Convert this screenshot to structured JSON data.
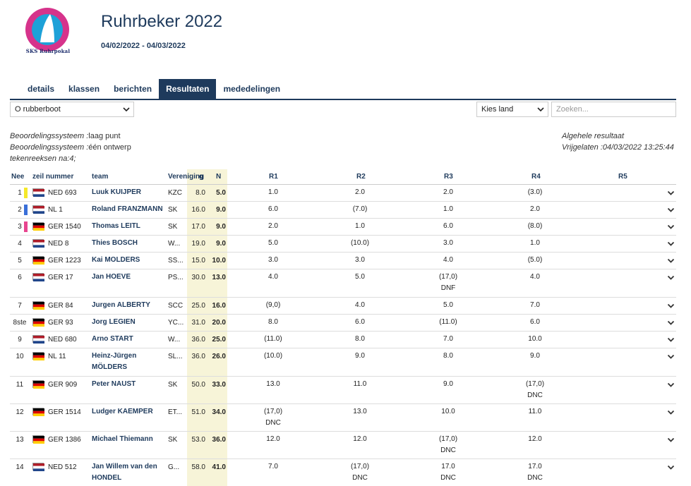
{
  "logo": {
    "text": "SKS Ruhrpokal",
    "colors": {
      "ring": "#d6338b",
      "inner": "#1da1d8",
      "sail": "#ffffff"
    }
  },
  "event": {
    "title": "Ruhrbeker 2022",
    "dates": "04/02/2022 - 04/03/2022"
  },
  "tabs": [
    {
      "label": "details",
      "active": false
    },
    {
      "label": "klassen",
      "active": false
    },
    {
      "label": "berichten",
      "active": false
    },
    {
      "label": "Resultaten",
      "active": true
    },
    {
      "label": "mededelingen",
      "active": false
    }
  ],
  "filters": {
    "class_select": "O rubberboot",
    "country_select": "Kies land",
    "search_placeholder": "Zoeken..."
  },
  "info": {
    "scoring_label_1": "Beoordelingssysteem :",
    "scoring_value_1": "laag punt",
    "scoring_label_2": "Beoordelingssysteem :",
    "scoring_value_2": "één ontwerp",
    "discards_label": "tekenreeksen na:",
    "discards_value": "4;",
    "overall": "Algehele resultaat",
    "released_label": "Vrijgelaten :",
    "released_value": "04/03/2022 13:25:44"
  },
  "table": {
    "headers": {
      "rank": "Nee",
      "sail": "zeil nummer",
      "team": "team",
      "club": "Vereniging",
      "g": "g",
      "n": "N",
      "r1": "R1",
      "r2": "R2",
      "r3": "R3",
      "r4": "R4",
      "r5": "R5"
    },
    "rows": [
      {
        "rank": "1",
        "color": "#f5e829",
        "flag": "NED",
        "sail": "NED 693",
        "name1": "Luuk KUIJPER",
        "name2": "",
        "club": "KZC",
        "g": "8.0",
        "n": "5.0",
        "r1": [
          "1.0",
          ""
        ],
        "r2": [
          "2.0",
          ""
        ],
        "r3": [
          "2.0",
          ""
        ],
        "r4": [
          "(3.0)",
          ""
        ]
      },
      {
        "rank": "2",
        "color": "#3a6fd8",
        "flag": "NED",
        "sail": "NL 1",
        "name1": "Roland FRANZMANN",
        "name2": "",
        "club": "SK",
        "g": "16.0",
        "n": "9.0",
        "r1": [
          "6.0",
          ""
        ],
        "r2": [
          "(7.0)",
          ""
        ],
        "r3": [
          "1.0",
          ""
        ],
        "r4": [
          "2.0",
          ""
        ]
      },
      {
        "rank": "3",
        "color": "#e8458f",
        "flag": "GER",
        "sail": "GER 1540",
        "name1": "Thomas LEITL",
        "name2": "",
        "club": "SK",
        "g": "17.0",
        "n": "9.0",
        "r1": [
          "2.0",
          ""
        ],
        "r2": [
          "1.0",
          ""
        ],
        "r3": [
          "6.0",
          ""
        ],
        "r4": [
          "(8.0)",
          ""
        ]
      },
      {
        "rank": "4",
        "color": "",
        "flag": "NED",
        "sail": "NED 8",
        "name1": "Thies BOSCH",
        "name2": "",
        "club": "W...",
        "g": "19.0",
        "n": "9.0",
        "r1": [
          "5.0",
          ""
        ],
        "r2": [
          "(10.0)",
          ""
        ],
        "r3": [
          "3.0",
          ""
        ],
        "r4": [
          "1.0",
          ""
        ]
      },
      {
        "rank": "5",
        "color": "",
        "flag": "GER",
        "sail": "GER 1223",
        "name1": "Kai MOLDERS",
        "name2": "",
        "club": "SS...",
        "g": "15.0",
        "n": "10.0",
        "r1": [
          "3.0",
          ""
        ],
        "r2": [
          "3.0",
          ""
        ],
        "r3": [
          "4.0",
          ""
        ],
        "r4": [
          "(5.0)",
          ""
        ]
      },
      {
        "rank": "6",
        "color": "",
        "flag": "NED",
        "sail": "GER 17",
        "name1": "Jan HOEVE",
        "name2": "",
        "club": "PS...",
        "g": "30.0",
        "n": "13.0",
        "r1": [
          "4.0",
          ""
        ],
        "r2": [
          "5.0",
          ""
        ],
        "r3": [
          "(17,0)",
          "DNF"
        ],
        "r4": [
          "4.0",
          ""
        ]
      },
      {
        "rank": "7",
        "color": "",
        "flag": "GER",
        "sail": "GER 84",
        "name1": "Jurgen ALBERTY",
        "name2": "",
        "club": "SCC",
        "g": "25.0",
        "n": "16.0",
        "r1": [
          "(9,0)",
          ""
        ],
        "r2": [
          "4.0",
          ""
        ],
        "r3": [
          "5.0",
          ""
        ],
        "r4": [
          "7.0",
          ""
        ]
      },
      {
        "rank": "8ste",
        "color": "",
        "flag": "GER",
        "sail": "GER 93",
        "name1": "Jorg LEGIEN",
        "name2": "",
        "club": "YC...",
        "g": "31.0",
        "n": "20.0",
        "r1": [
          "8.0",
          ""
        ],
        "r2": [
          "6.0",
          ""
        ],
        "r3": [
          "(11.0)",
          ""
        ],
        "r4": [
          "6.0",
          ""
        ]
      },
      {
        "rank": "9",
        "color": "",
        "flag": "NED",
        "sail": "NED 680",
        "name1": "Arno START",
        "name2": "",
        "club": "W...",
        "g": "36.0",
        "n": "25.0",
        "r1": [
          "(11.0)",
          ""
        ],
        "r2": [
          "8.0",
          ""
        ],
        "r3": [
          "7.0",
          ""
        ],
        "r4": [
          "10.0",
          ""
        ]
      },
      {
        "rank": "10",
        "color": "",
        "flag": "GER",
        "sail": "NL 11",
        "name1": "Heinz-Jürgen",
        "name2": "MÖLDERS",
        "club": "SL...",
        "g": "36.0",
        "n": "26.0",
        "r1": [
          "(10.0)",
          ""
        ],
        "r2": [
          "9.0",
          ""
        ],
        "r3": [
          "8.0",
          ""
        ],
        "r4": [
          "9.0",
          ""
        ]
      },
      {
        "rank": "11",
        "color": "",
        "flag": "GER",
        "sail": "GER 909",
        "name1": "Peter NAUST",
        "name2": "",
        "club": "SK",
        "g": "50.0",
        "n": "33.0",
        "r1": [
          "13.0",
          ""
        ],
        "r2": [
          "11.0",
          ""
        ],
        "r3": [
          "9.0",
          ""
        ],
        "r4": [
          "(17,0)",
          "DNC"
        ]
      },
      {
        "rank": "12",
        "color": "",
        "flag": "GER",
        "sail": "GER 1514",
        "name1": "Ludger KAEMPER",
        "name2": "",
        "club": "ET...",
        "g": "51.0",
        "n": "34.0",
        "r1": [
          "(17,0)",
          "DNC"
        ],
        "r2": [
          "13.0",
          ""
        ],
        "r3": [
          "10.0",
          ""
        ],
        "r4": [
          "11.0",
          ""
        ]
      },
      {
        "rank": "13",
        "color": "",
        "flag": "GER",
        "sail": "GER 1386",
        "name1": "Michael Thiemann",
        "name2": "",
        "club": "SK",
        "g": "53.0",
        "n": "36.0",
        "r1": [
          "12.0",
          ""
        ],
        "r2": [
          "12.0",
          ""
        ],
        "r3": [
          "(17,0)",
          "DNC"
        ],
        "r4": [
          "12.0",
          ""
        ]
      },
      {
        "rank": "14",
        "color": "",
        "flag": "NED",
        "sail": "NED 512",
        "name1": "Jan Willem van den",
        "name2": "HONDEL",
        "club": "G...",
        "g": "58.0",
        "n": "41.0",
        "r1": [
          "7.0",
          ""
        ],
        "r2": [
          "(17,0)",
          "DNC"
        ],
        "r3": [
          "17.0",
          "DNC"
        ],
        "r4": [
          "17.0",
          "DNC"
        ]
      }
    ]
  },
  "icons": {
    "row_expand": "chevron-down-icon",
    "select_caret": "chevron-down-icon"
  }
}
